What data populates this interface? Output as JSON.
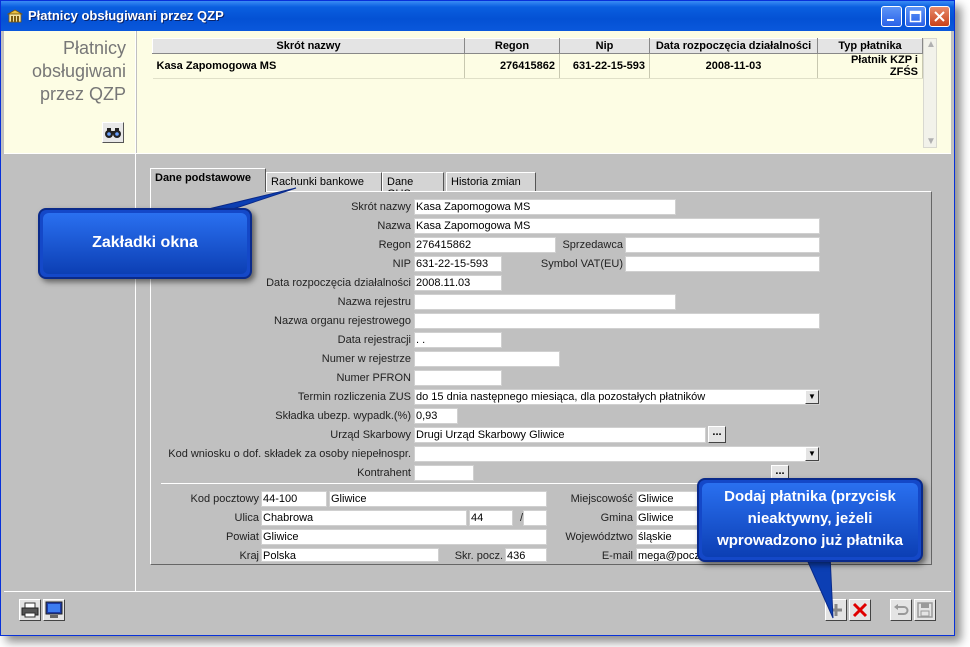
{
  "window": {
    "title": "Płatnicy obsługiwani przez QZP"
  },
  "left_panel": {
    "title_lines": [
      "Płatnicy",
      "obsługiwani",
      "przez QZP"
    ]
  },
  "grid": {
    "columns": [
      "Skrót nazwy",
      "Regon",
      "Nip",
      "Data rozpoczęcia działalności",
      "Typ płatnika"
    ],
    "rows": [
      [
        "Kasa Zapomogowa MS",
        "276415862",
        "631-22-15-593",
        "2008-11-03",
        "Płatnik KZP i ZFŚS"
      ]
    ]
  },
  "tabs": [
    {
      "label": "Dane podstawowe",
      "active": true
    },
    {
      "label": "Rachunki bankowe",
      "active": false
    },
    {
      "label": "Dane GUS",
      "active": false
    },
    {
      "label": "Historia zmian",
      "active": false
    }
  ],
  "form": {
    "skrot_label": "Skrót nazwy",
    "skrot_value": "Kasa Zapomogowa MS",
    "nazwa_label": "Nazwa",
    "nazwa_value": "Kasa Zapomogowa MS",
    "regon_label": "Regon",
    "regon_value": "276415862",
    "sprzedawca_label": "Sprzedawca",
    "sprzedawca_value": "",
    "nip_label": "NIP",
    "nip_value": "631-22-15-593",
    "vat_label": "Symbol VAT(EU)",
    "vat_value": "",
    "data_rozp_label": "Data rozpoczęcia działalności",
    "data_rozp_value": "2008.11.03",
    "nazwa_rej_label": "Nazwa rejestru",
    "nazwa_rej_value": "",
    "nazwa_org_label": "Nazwa organu rejestrowego",
    "nazwa_org_value": "",
    "data_rej_label": "Data rejestracji",
    "data_rej_value": "  .  .",
    "numer_rej_label": "Numer w rejestrze",
    "numer_rej_value": "",
    "pfron_label": "Numer PFRON",
    "pfron_value": "",
    "termin_label": "Termin rozliczenia ZUS",
    "termin_value": "do 15 dnia następnego miesiąca, dla pozostałych płatników",
    "skladka_label": "Składka ubezp. wypadk.(%)",
    "skladka_value": "0,93",
    "urzad_label": "Urząd Skarbowy",
    "urzad_value": "Drugi Urząd Skarbowy Gliwice",
    "kod_wniosku_label": "Kod wniosku o dof. składek za osoby niepełnospr.",
    "kod_wniosku_value": "",
    "kontrahent_label": "Kontrahent",
    "kontrahent_value": "",
    "kod_poczt_label": "Kod pocztowy",
    "kod_poczt_value": "44-100",
    "poczta_value": "Gliwice",
    "miejscowosc_label": "Miejscowość",
    "miejscowosc_value": "Gliwice",
    "ulica_label": "Ulica",
    "ulica_value": "Chabrowa",
    "nr_domu_value": "44",
    "slash": "/",
    "nr_lok_value": "",
    "gmina_label": "Gmina",
    "gmina_value": "Gliwice",
    "powiat_label": "Powiat",
    "powiat_value": "Gliwice",
    "wojewodztwo_label": "Województwo",
    "wojewodztwo_value": "śląskie",
    "kraj_label": "Kraj",
    "kraj_value": "Polska",
    "skr_pocz_label": "Skr. pocz.",
    "skr_pocz_value": "436",
    "email_label": "E-mail",
    "email_value": "mega@poczta.pl",
    "ellipsis": "..."
  },
  "callouts": {
    "tabs": "Zakładki okna",
    "add_lines": [
      "Dodaj płatnika (przycisk",
      "nieaktywny, jeżeli",
      "wprowadzono już płatnika"
    ]
  },
  "colors": {
    "titlebar": "#0451d4",
    "panel_bg": "#fdfde4",
    "callout": "#1448c8",
    "delete": "#e00000"
  }
}
